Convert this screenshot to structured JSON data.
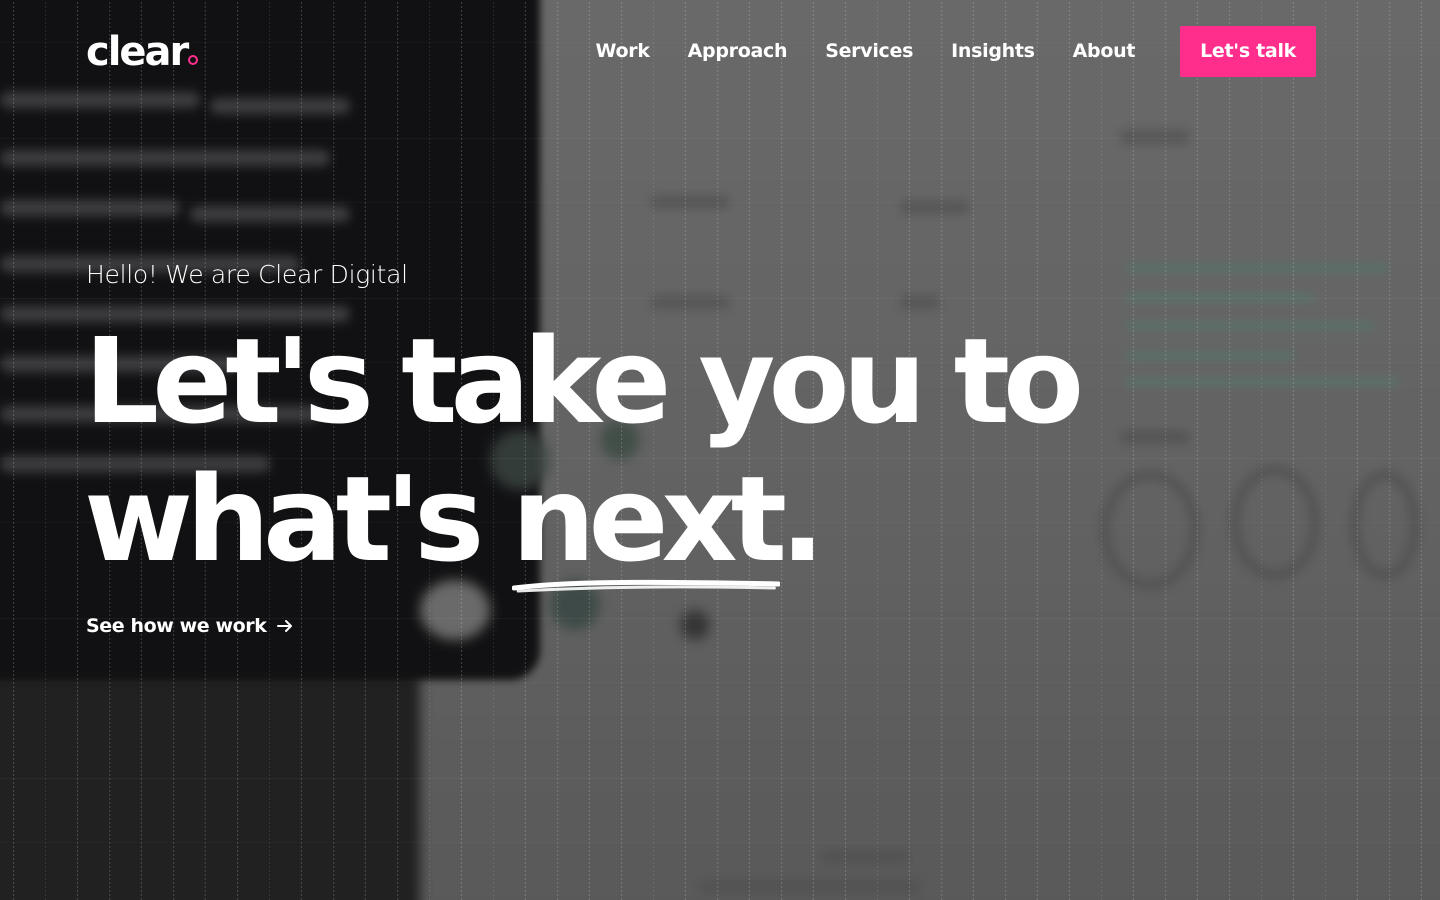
{
  "header": {
    "logo_text": "clear",
    "nav": [
      {
        "label": "Work"
      },
      {
        "label": "Approach"
      },
      {
        "label": "Services"
      },
      {
        "label": "Insights"
      },
      {
        "label": "About"
      }
    ],
    "cta_label": "Let's talk"
  },
  "hero": {
    "eyebrow": "Hello! We are Clear Digital",
    "headline_line1": "Let's take you to",
    "headline_line2_start": "what's ",
    "headline_emphasis": "next",
    "headline_end": ".",
    "link_label": "See how we work",
    "link_icon": "arrow-right-icon"
  },
  "colors": {
    "accent": "#ff2e8d",
    "text": "#ffffff",
    "overlay": "#141414"
  }
}
